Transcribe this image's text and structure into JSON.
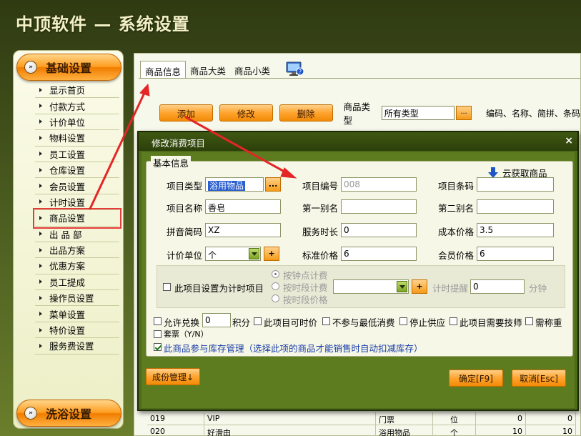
{
  "app_title": "中顶软件 — 系统设置",
  "sidebar": {
    "top_section": "基础设置",
    "bottom_section": "洗浴设置",
    "items": [
      {
        "label": "显示首页"
      },
      {
        "label": "付款方式"
      },
      {
        "label": "计价单位"
      },
      {
        "label": "物料设置"
      },
      {
        "label": "员工设置"
      },
      {
        "label": "仓库设置"
      },
      {
        "label": "会员设置"
      },
      {
        "label": "计时设置"
      },
      {
        "label": "商品设置",
        "active": true
      },
      {
        "label": "出 品 部"
      },
      {
        "label": "出品方案"
      },
      {
        "label": "优惠方案"
      },
      {
        "label": "员工提成"
      },
      {
        "label": "操作员设置"
      },
      {
        "label": "菜单设置"
      },
      {
        "label": "特价设置"
      },
      {
        "label": "服务费设置"
      }
    ]
  },
  "main": {
    "tabs": [
      "商品信息",
      "商品大类",
      "商品小类"
    ],
    "toolbar": {
      "add": "添加",
      "edit": "修改",
      "delete": "删除",
      "type_label": "商品类型",
      "type_value": "所有类型",
      "dots": "...",
      "hint": "编码、名称、简拼、条码"
    },
    "rows": [
      {
        "code": "019",
        "name": "VIP",
        "category": "门票",
        "unit": "位",
        "v1": "0",
        "v2": "0"
      },
      {
        "code": "020",
        "name": "好滑由",
        "category": "浴用物品",
        "unit": "个",
        "v1": "10",
        "v2": "10"
      }
    ]
  },
  "dialog": {
    "title": "修改消费项目",
    "close": "×",
    "group_label": "基本信息",
    "cloud": "云获取商品",
    "fields": {
      "item_type_label": "项目类型",
      "item_type_value": "浴用物品",
      "item_code_label": "项目编号",
      "item_code_value": "008",
      "barcode_label": "项目条码",
      "barcode_value": "",
      "name_label": "项目名称",
      "name_value": "香皂",
      "alias1_label": "第一别名",
      "alias1_value": "",
      "alias2_label": "第二别名",
      "alias2_value": "",
      "pinyin_label": "拼音简码",
      "pinyin_value": "XZ",
      "duration_label": "服务时长",
      "duration_value": "0",
      "cost_label": "成本价格",
      "cost_value": "3.5",
      "unit_label": "计价单位",
      "unit_value": "个",
      "std_price_label": "标准价格",
      "std_price_value": "6",
      "member_price_label": "会员价格",
      "member_price_value": "6",
      "dots": "...",
      "plus": "+"
    },
    "timer": {
      "checkbox_label": "此项目设置为计时项目",
      "radio1": "按钟点计费",
      "radio2": "按时段计费",
      "radio3": "按时段价格",
      "remind_label": "计时提醒",
      "remind_value": "0",
      "minutes": "分钟"
    },
    "options": {
      "exchange": "允许兑换",
      "exchange_value": "0",
      "points": "积分",
      "time_price": "此项目可时价",
      "no_min": "不参与最低消费",
      "stop_supply": "停止供应",
      "need_tech": "此项目需要技师",
      "weigh": "需称重",
      "package": "套票（Y/N）",
      "inventory": "此商品参与库存管理（选择此项的商品才能销售时自动扣减库存）"
    },
    "buttons": {
      "bom": "成份管理↓",
      "ok": "确定[F9]",
      "cancel": "取消[Esc]"
    }
  }
}
